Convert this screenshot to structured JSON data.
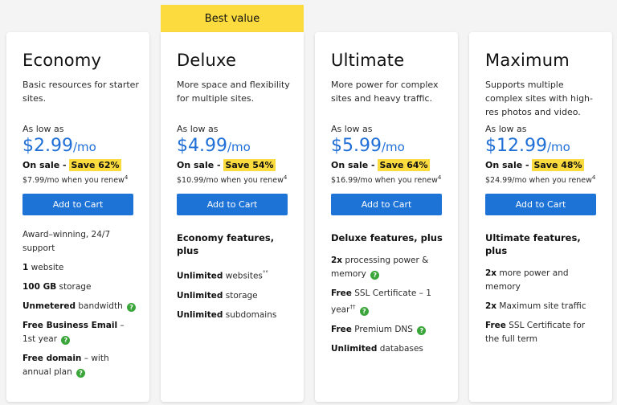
{
  "badge": "Best value",
  "as_low_label": "As low as",
  "per": "/mo",
  "sale_prefix": "On sale - ",
  "cart_label": "Add to Cart",
  "colors": {
    "accent": "#1e73d6",
    "highlight": "#fcdb3f",
    "help": "#3aa63a"
  },
  "icons": {
    "help": "help-circle-icon"
  },
  "plans": [
    {
      "name": "Economy",
      "desc": "Basic resources for starter sites.",
      "price": "$2.99",
      "save": "Save 62%",
      "renew": "$7.99/mo when you renew",
      "renew_note": "4",
      "features_head": "",
      "features": [
        {
          "bold": "",
          "text": "Award–winning, 24/7 support",
          "sup": "",
          "help": false
        },
        {
          "bold": "1",
          "text": " website",
          "sup": "",
          "help": false
        },
        {
          "bold": "100 GB",
          "text": " storage",
          "sup": "",
          "help": false
        },
        {
          "bold": "Unmetered",
          "text": " bandwidth",
          "sup": "",
          "help": true
        },
        {
          "bold": "Free Business Email",
          "text": " – 1st year",
          "sup": "",
          "help": true
        },
        {
          "bold": "Free domain",
          "text": " – with annual plan",
          "sup": "",
          "help": true
        }
      ]
    },
    {
      "name": "Deluxe",
      "desc": "More space and flexibility for multiple sites.",
      "price": "$4.99",
      "save": "Save 54%",
      "renew": "$10.99/mo when you renew",
      "renew_note": "4",
      "features_head": "Economy features, plus",
      "features": [
        {
          "bold": "Unlimited",
          "text": " websites",
          "sup": "°°",
          "help": false
        },
        {
          "bold": "Unlimited",
          "text": " storage",
          "sup": "",
          "help": false
        },
        {
          "bold": "Unlimited",
          "text": " subdomains",
          "sup": "",
          "help": false
        }
      ]
    },
    {
      "name": "Ultimate",
      "desc": "More power for complex sites and heavy traffic.",
      "price": "$5.99",
      "save": "Save 64%",
      "renew": "$16.99/mo when you renew",
      "renew_note": "4",
      "features_head": "Deluxe features, plus",
      "features": [
        {
          "bold": "2x",
          "text": " processing power & memory",
          "sup": "",
          "help": true
        },
        {
          "bold": "Free",
          "text": " SSL Certificate – 1 year",
          "sup": "††",
          "help": true
        },
        {
          "bold": "Free",
          "text": " Premium DNS",
          "sup": "",
          "help": true
        },
        {
          "bold": "Unlimited",
          "text": " databases",
          "sup": "",
          "help": false
        }
      ]
    },
    {
      "name": "Maximum",
      "desc": "Supports multiple complex sites with high-res photos and video.",
      "price": "$12.99",
      "save": "Save 48%",
      "renew": "$24.99/mo when you renew",
      "renew_note": "4",
      "features_head": "Ultimate features, plus",
      "features": [
        {
          "bold": "2x",
          "text": " more power and memory",
          "sup": "",
          "help": false
        },
        {
          "bold": "2x",
          "text": " Maximum site traffic",
          "sup": "",
          "help": false
        },
        {
          "bold": "Free",
          "text": " SSL Certificate for the full term",
          "sup": "",
          "help": false
        }
      ]
    }
  ]
}
